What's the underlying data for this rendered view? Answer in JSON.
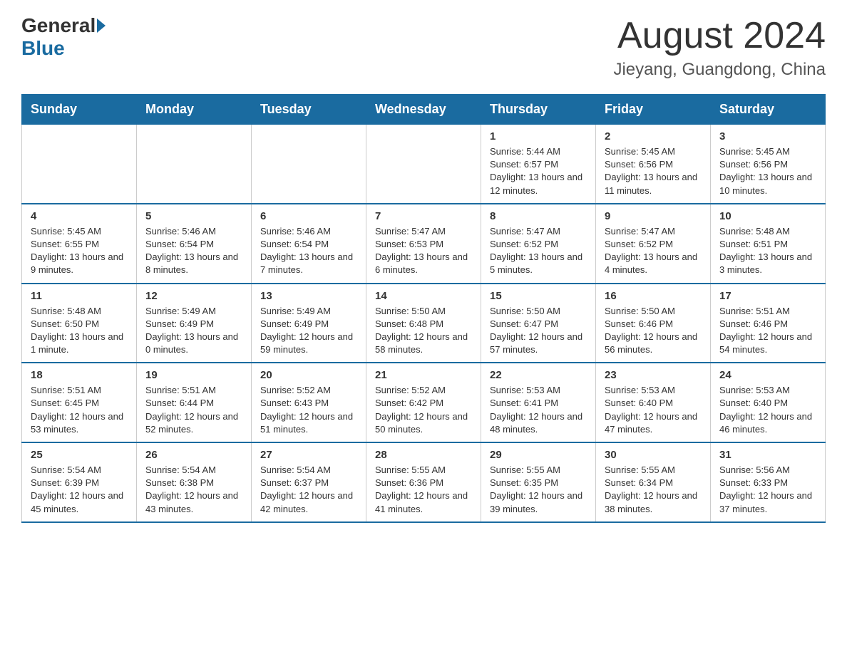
{
  "header": {
    "logo_general": "General",
    "logo_blue": "Blue",
    "title": "August 2024",
    "subtitle": "Jieyang, Guangdong, China"
  },
  "days_of_week": [
    "Sunday",
    "Monday",
    "Tuesday",
    "Wednesday",
    "Thursday",
    "Friday",
    "Saturday"
  ],
  "weeks": [
    [
      {
        "day": "",
        "info": ""
      },
      {
        "day": "",
        "info": ""
      },
      {
        "day": "",
        "info": ""
      },
      {
        "day": "",
        "info": ""
      },
      {
        "day": "1",
        "info": "Sunrise: 5:44 AM\nSunset: 6:57 PM\nDaylight: 13 hours and 12 minutes."
      },
      {
        "day": "2",
        "info": "Sunrise: 5:45 AM\nSunset: 6:56 PM\nDaylight: 13 hours and 11 minutes."
      },
      {
        "day": "3",
        "info": "Sunrise: 5:45 AM\nSunset: 6:56 PM\nDaylight: 13 hours and 10 minutes."
      }
    ],
    [
      {
        "day": "4",
        "info": "Sunrise: 5:45 AM\nSunset: 6:55 PM\nDaylight: 13 hours and 9 minutes."
      },
      {
        "day": "5",
        "info": "Sunrise: 5:46 AM\nSunset: 6:54 PM\nDaylight: 13 hours and 8 minutes."
      },
      {
        "day": "6",
        "info": "Sunrise: 5:46 AM\nSunset: 6:54 PM\nDaylight: 13 hours and 7 minutes."
      },
      {
        "day": "7",
        "info": "Sunrise: 5:47 AM\nSunset: 6:53 PM\nDaylight: 13 hours and 6 minutes."
      },
      {
        "day": "8",
        "info": "Sunrise: 5:47 AM\nSunset: 6:52 PM\nDaylight: 13 hours and 5 minutes."
      },
      {
        "day": "9",
        "info": "Sunrise: 5:47 AM\nSunset: 6:52 PM\nDaylight: 13 hours and 4 minutes."
      },
      {
        "day": "10",
        "info": "Sunrise: 5:48 AM\nSunset: 6:51 PM\nDaylight: 13 hours and 3 minutes."
      }
    ],
    [
      {
        "day": "11",
        "info": "Sunrise: 5:48 AM\nSunset: 6:50 PM\nDaylight: 13 hours and 1 minute."
      },
      {
        "day": "12",
        "info": "Sunrise: 5:49 AM\nSunset: 6:49 PM\nDaylight: 13 hours and 0 minutes."
      },
      {
        "day": "13",
        "info": "Sunrise: 5:49 AM\nSunset: 6:49 PM\nDaylight: 12 hours and 59 minutes."
      },
      {
        "day": "14",
        "info": "Sunrise: 5:50 AM\nSunset: 6:48 PM\nDaylight: 12 hours and 58 minutes."
      },
      {
        "day": "15",
        "info": "Sunrise: 5:50 AM\nSunset: 6:47 PM\nDaylight: 12 hours and 57 minutes."
      },
      {
        "day": "16",
        "info": "Sunrise: 5:50 AM\nSunset: 6:46 PM\nDaylight: 12 hours and 56 minutes."
      },
      {
        "day": "17",
        "info": "Sunrise: 5:51 AM\nSunset: 6:46 PM\nDaylight: 12 hours and 54 minutes."
      }
    ],
    [
      {
        "day": "18",
        "info": "Sunrise: 5:51 AM\nSunset: 6:45 PM\nDaylight: 12 hours and 53 minutes."
      },
      {
        "day": "19",
        "info": "Sunrise: 5:51 AM\nSunset: 6:44 PM\nDaylight: 12 hours and 52 minutes."
      },
      {
        "day": "20",
        "info": "Sunrise: 5:52 AM\nSunset: 6:43 PM\nDaylight: 12 hours and 51 minutes."
      },
      {
        "day": "21",
        "info": "Sunrise: 5:52 AM\nSunset: 6:42 PM\nDaylight: 12 hours and 50 minutes."
      },
      {
        "day": "22",
        "info": "Sunrise: 5:53 AM\nSunset: 6:41 PM\nDaylight: 12 hours and 48 minutes."
      },
      {
        "day": "23",
        "info": "Sunrise: 5:53 AM\nSunset: 6:40 PM\nDaylight: 12 hours and 47 minutes."
      },
      {
        "day": "24",
        "info": "Sunrise: 5:53 AM\nSunset: 6:40 PM\nDaylight: 12 hours and 46 minutes."
      }
    ],
    [
      {
        "day": "25",
        "info": "Sunrise: 5:54 AM\nSunset: 6:39 PM\nDaylight: 12 hours and 45 minutes."
      },
      {
        "day": "26",
        "info": "Sunrise: 5:54 AM\nSunset: 6:38 PM\nDaylight: 12 hours and 43 minutes."
      },
      {
        "day": "27",
        "info": "Sunrise: 5:54 AM\nSunset: 6:37 PM\nDaylight: 12 hours and 42 minutes."
      },
      {
        "day": "28",
        "info": "Sunrise: 5:55 AM\nSunset: 6:36 PM\nDaylight: 12 hours and 41 minutes."
      },
      {
        "day": "29",
        "info": "Sunrise: 5:55 AM\nSunset: 6:35 PM\nDaylight: 12 hours and 39 minutes."
      },
      {
        "day": "30",
        "info": "Sunrise: 5:55 AM\nSunset: 6:34 PM\nDaylight: 12 hours and 38 minutes."
      },
      {
        "day": "31",
        "info": "Sunrise: 5:56 AM\nSunset: 6:33 PM\nDaylight: 12 hours and 37 minutes."
      }
    ]
  ]
}
